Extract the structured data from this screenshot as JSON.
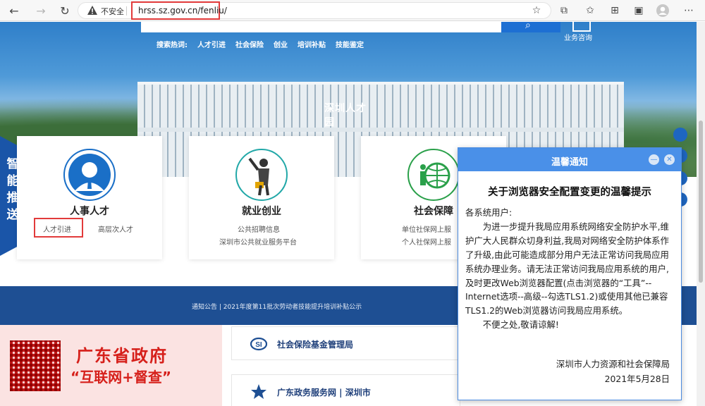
{
  "browser": {
    "insecure_label": "不安全",
    "url": "hrss.sz.gov.cn/fenliu/"
  },
  "hero": {
    "hot_label": "搜索热词:",
    "hot_words": [
      "人才引进",
      "社会保险",
      "创业",
      "培训补贴",
      "技能鉴定"
    ],
    "consult_label": "业务咨询",
    "building_sign": "深圳人才园"
  },
  "ribbon": {
    "label": "智能推送"
  },
  "cards": [
    {
      "title": "人事人才",
      "subs": [
        "人才引进",
        "高层次人才"
      ]
    },
    {
      "title": "就业创业",
      "subs": [
        "公共招聘信息",
        "深圳市公共就业服务平台"
      ]
    },
    {
      "title": "社会保障",
      "subs": [
        "单位社保网上服",
        "个人社保网上服"
      ]
    }
  ],
  "notice": {
    "text": "通知公告 |  2021年度第11批次劳动者技能提升培训补贴公示"
  },
  "bottom": {
    "gov_title": "广东省政府",
    "gov_sub": "“互联网+督查”",
    "links": [
      "社会保险基金管理局",
      "广东政务服务网 | 深圳市"
    ]
  },
  "popup": {
    "header": "温馨通知",
    "title": "关于浏览器安全配置变更的温馨提示",
    "greeting": "各系统用户:",
    "para1": "为进一步提升我局应用系统网络安全防护水平,维护广大人民群众切身利益,我局对网络安全防护体系作了升级,由此可能造成部分用户无法正常访问我局应用系统办理业务。请无法正常访问我局应用系统的用户,及时更改Web浏览器配置(点击浏览器的“工具”--Internet选项--高级--勾选TLS1.2)或使用其他已兼容TLS1.2的Web浏览器访问我局应用系统。",
    "para2": "不便之处,敬请谅解!",
    "org": "深圳市人力资源和社会保障局",
    "date": "2021年5月28日",
    "minimize": "—",
    "close": "✕"
  },
  "colors": {
    "primary_blue": "#1e4f93",
    "popup_head": "#4a90e8",
    "highlight_red": "#e23b3b",
    "gov_red": "#d6201b"
  }
}
